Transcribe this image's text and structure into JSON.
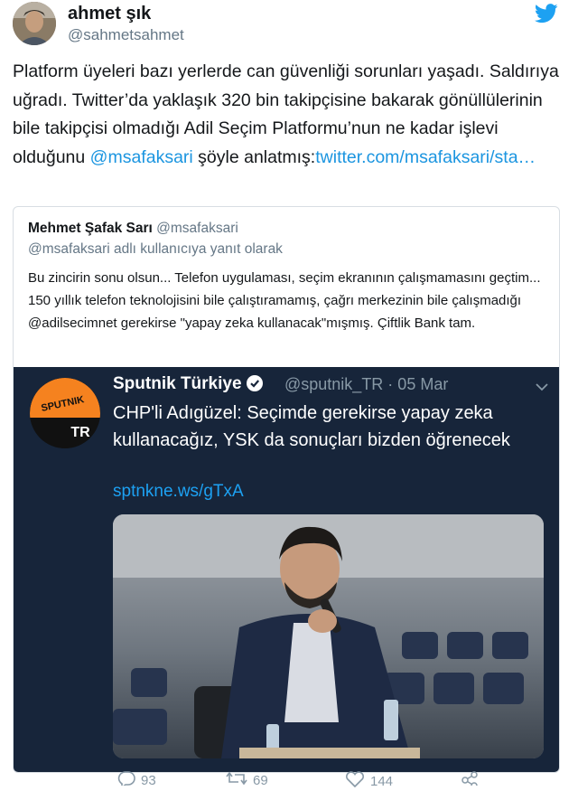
{
  "author": {
    "name": "ahmet şık",
    "handle": "@sahmetsahmet"
  },
  "tweet": {
    "text_part1": "Platform üyeleri bazı yerlerde can güvenliği sorunları yaşadı. Saldırıya uğradı. Twitter’da yaklaşık 320 bin takipçisine bakarak gönüllülerinin bile takipçisi olmadığı Adil Seçim Platformu’nun ne kadar işlevi olduğunu ",
    "mention": "@msafaksari",
    "text_part2": " şöyle anlatmış:",
    "link": "twitter.com/msafaksari/sta…"
  },
  "quoted": {
    "name": "Mehmet Şafak Sarı",
    "handle": "@msafaksari",
    "reply_note": "@msafaksari adlı kullanıcıya yanıt olarak",
    "text": "Bu zincirin sonu olsun... Telefon uygulaması, seçim ekranının çalışmamasını geçtim... 150 yıllık telefon teknolojisini bile çalıştıramamış, çağrı merkezinin bile çalışmadığı @adilsecimnet gerekirse \"yapay zeka kullanacak\"mışmış. Çiftlik Bank tam."
  },
  "embedded": {
    "name": "Sputnik Türkiye",
    "handle_date": "@sputnik_TR · 05 Mar",
    "text": "CHP'li Adıgüzel: Seçimde gerekirse yapay zeka kullanacağız, YSK da sonuçları bizden öğrenecek",
    "link": "sptnkne.ws/gTxA",
    "logo_top": "SPUTNIK",
    "logo_bottom": "TR"
  },
  "actions": {
    "replies": "93",
    "retweets": "69",
    "likes": "144"
  },
  "colors": {
    "link": "#1b95e0",
    "embed_bg": "#17253a",
    "sputnik_orange": "#f5821f"
  }
}
